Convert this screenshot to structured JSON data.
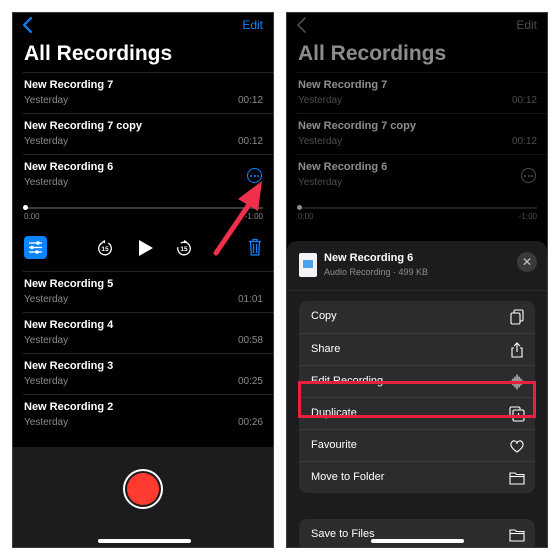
{
  "left_screen": {
    "nav": {
      "edit_label": "Edit",
      "back_icon": "chevron-left-icon"
    },
    "title": "All Recordings",
    "recordings_top": [
      {
        "name": "New Recording 7",
        "date": "Yesterday",
        "duration": "00:12"
      },
      {
        "name": "New Recording 7 copy",
        "date": "Yesterday",
        "duration": "00:12"
      }
    ],
    "expanded": {
      "name": "New Recording 6",
      "date": "Yesterday",
      "time_elapsed": "0:00",
      "time_remaining": "-1:00",
      "progress": 0,
      "skip_back_label": "15",
      "skip_forward_label": "15"
    },
    "recordings_bottom": [
      {
        "name": "New Recording 5",
        "date": "Yesterday",
        "duration": "01:01"
      },
      {
        "name": "New Recording 4",
        "date": "Yesterday",
        "duration": "00:58"
      },
      {
        "name": "New Recording 3",
        "date": "Yesterday",
        "duration": "00:25"
      },
      {
        "name": "New Recording 2",
        "date": "Yesterday",
        "duration": "00:26"
      }
    ]
  },
  "right_screen": {
    "nav": {
      "edit_label": "Edit"
    },
    "title": "All Recordings",
    "recordings_top": [
      {
        "name": "New Recording 7",
        "date": "Yesterday",
        "duration": "00:12"
      },
      {
        "name": "New Recording 7 copy",
        "date": "Yesterday",
        "duration": "00:12"
      }
    ],
    "expanded": {
      "name": "New Recording 6",
      "date": "Yesterday",
      "time_elapsed": "0:00",
      "time_remaining": "-1:00"
    },
    "share_sheet": {
      "file_name": "New Recording 6",
      "file_info": "Audio Recording · 499 KB",
      "close_glyph": "✕",
      "group1": [
        {
          "label": "Copy",
          "icon": "copy-icon"
        },
        {
          "label": "Share",
          "icon": "share-icon"
        },
        {
          "label": "Edit Recording",
          "icon": "waveform-icon",
          "highlighted": true
        },
        {
          "label": "Duplicate",
          "icon": "duplicate-icon"
        },
        {
          "label": "Favourite",
          "icon": "heart-icon"
        },
        {
          "label": "Move to Folder",
          "icon": "folder-icon"
        }
      ],
      "group2": [
        {
          "label": "Save to Files",
          "icon": "folder-icon"
        }
      ]
    }
  },
  "colors": {
    "accent": "#0a84ff",
    "record": "#ff3b30",
    "highlight": "#e8213f",
    "arrow": "#f0304a"
  }
}
